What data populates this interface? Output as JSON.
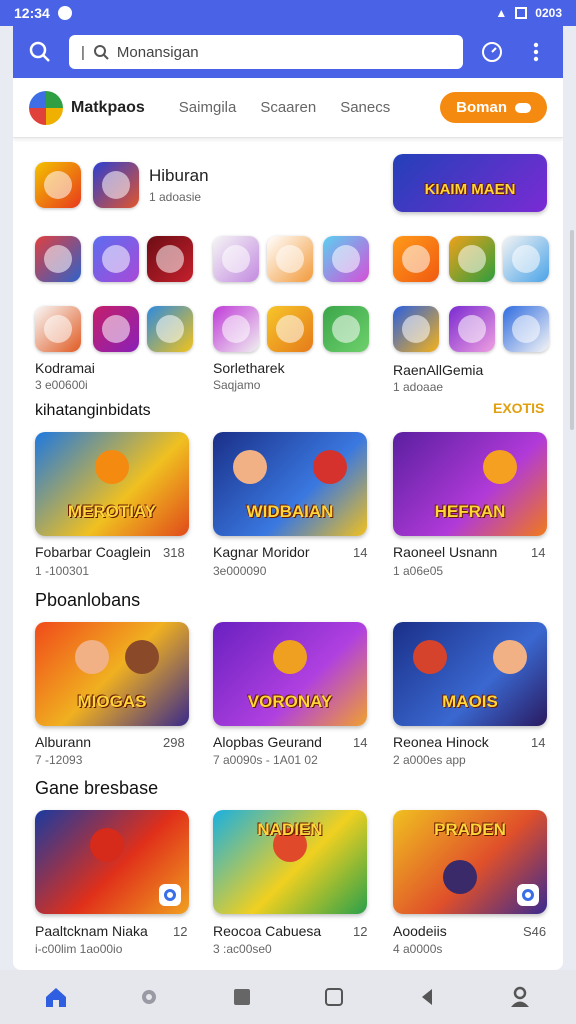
{
  "status": {
    "time": "12:34",
    "right_text": "0203"
  },
  "search": {
    "placeholder": "Monansigan",
    "cursor_text": "|"
  },
  "header": {
    "brand": "Matkpaos",
    "tabs": [
      "Saimgila",
      "Scaaren",
      "Sanecs"
    ],
    "pill_label": "Boman"
  },
  "featured": {
    "title": "Hiburan",
    "subtitle": "1 adoasie",
    "banner_text": "KIAIM MAEN"
  },
  "icon_groups": [
    {
      "label": "Kodramai",
      "sub": "3 e00600i"
    },
    {
      "label": "Sorletharek",
      "sub": "Saqjamo"
    },
    {
      "label": "RaenAllGemia",
      "sub": "1 adoaae"
    }
  ],
  "sections": [
    {
      "title": "kihatanginbidats",
      "badge": "EXOTIS",
      "cards": [
        {
          "banner": "MEROTIAY",
          "title": "Fobarbar Coaglein",
          "rating": "318",
          "sub": "1 -100301"
        },
        {
          "banner": "WIDBAIAN",
          "title": "Kagnar Moridor",
          "rating": "14",
          "sub": "3e000090"
        },
        {
          "banner": "HEFRAN",
          "title": "Raoneel Usnann",
          "rating": "14",
          "sub": "1 a06e05"
        }
      ]
    },
    {
      "title": "Pboanlobans",
      "cards": [
        {
          "banner": "MIOGAS",
          "title": "Alburann",
          "rating": "298",
          "sub": "7 -12093"
        },
        {
          "banner": "VORONAY",
          "title": "Alopbas Geurand",
          "rating": "14",
          "sub": "7 a0090s - 1A01 02"
        },
        {
          "banner": "MAOIS",
          "title": "Reonea Hinock",
          "rating": "14",
          "sub": "2 a000es app"
        }
      ]
    },
    {
      "title": "Gane bresbase",
      "cards": [
        {
          "banner": "",
          "title": "Paaltcknam Niaka",
          "rating": "12",
          "sub": "i-c00lim 1ao00io"
        },
        {
          "banner": "NADIEN",
          "title": "Reocoa Cabuesa",
          "rating": "12",
          "sub": "3 :ac00se0"
        },
        {
          "banner": "PRADEN",
          "title": "Aoodeiis",
          "rating": "S46",
          "sub": "4 a0000s"
        }
      ]
    }
  ],
  "colors": {
    "accent": "#4a63e6",
    "orange": "#f58a10",
    "panel": "#ffffff"
  },
  "icons": [
    "search-icon",
    "compass-icon",
    "more-vert-icon",
    "home-icon",
    "dot-icon",
    "square-icon",
    "back-icon",
    "profile-icon"
  ]
}
